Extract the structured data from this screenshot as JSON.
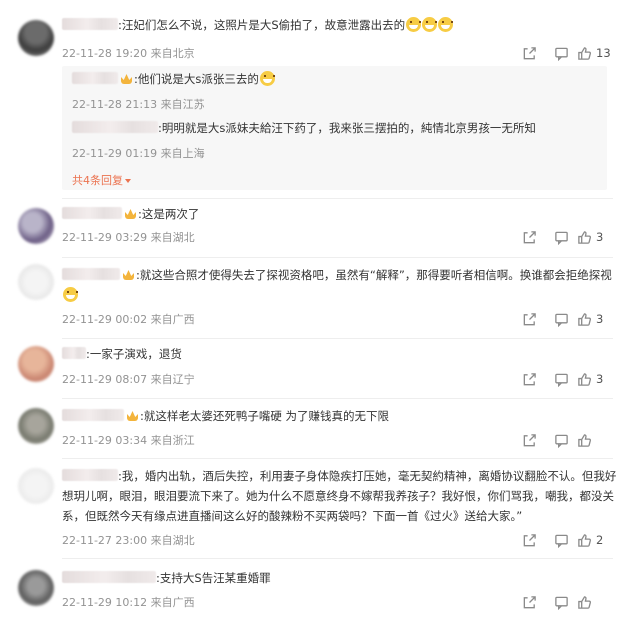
{
  "comments": [
    {
      "text": ":汪妃们怎么不说，这照片是大S偷拍了，故意泄露出去的",
      "emoji_count": 3,
      "meta": "22-11-28 19:20 来自北京",
      "likes": "13",
      "replies": [
        {
          "text": ":他们说是大s派张三去的",
          "meta": "22-11-28 21:13 来自江苏"
        },
        {
          "text": ":明明就是大s派妹夫給汪下药了，我来张三摆拍的，純情北京男孩一无所知",
          "meta": "22-11-29 01:19 来自上海"
        }
      ],
      "more_replies": "共4条回复"
    },
    {
      "text": ":这是两次了",
      "meta": "22-11-29 03:29 来自湖北",
      "likes": "3"
    },
    {
      "text": ":就这些合照才使得失去了探视资格吧，虽然有“解释”，那得要听者相信啊。换谁都会拒绝探视",
      "meta": "22-11-29 00:02 来自广西",
      "likes": "3"
    },
    {
      "text": ":一家子演戏，退货",
      "meta": "22-11-29 08:07 来自辽宁",
      "likes": "3"
    },
    {
      "text": ":就这样老太婆还死鸭子嘴硬   为了赚钱真的无下限",
      "meta": "22-11-29 03:34 来自浙江",
      "likes": ""
    },
    {
      "text": ":我，婚内出轨，酒后失控，利用妻子身体隐疾打压她，毫无契約精神，离婚协议翻脸不认。但我好想玥儿啊，眼泪，眼泪要流下来了。她为什么不愿意终身不嫁帮我养孩子？我好恨，你们骂我，嘲我，都没关系，但既然今天有缘点进直播间这么好的酸辣粉不买两袋吗？下面一首《过火》送给大家。”",
      "meta": "22-11-27 23:00 来自湖北",
      "likes": "2"
    },
    {
      "text": ":支持大S告汪某重婚罪",
      "meta": "22-11-29 10:12 来自广西",
      "likes": ""
    }
  ],
  "icons": {
    "share": "share-icon",
    "comment": "comment-icon",
    "like": "like-icon",
    "crown": "crown-badge-icon"
  }
}
